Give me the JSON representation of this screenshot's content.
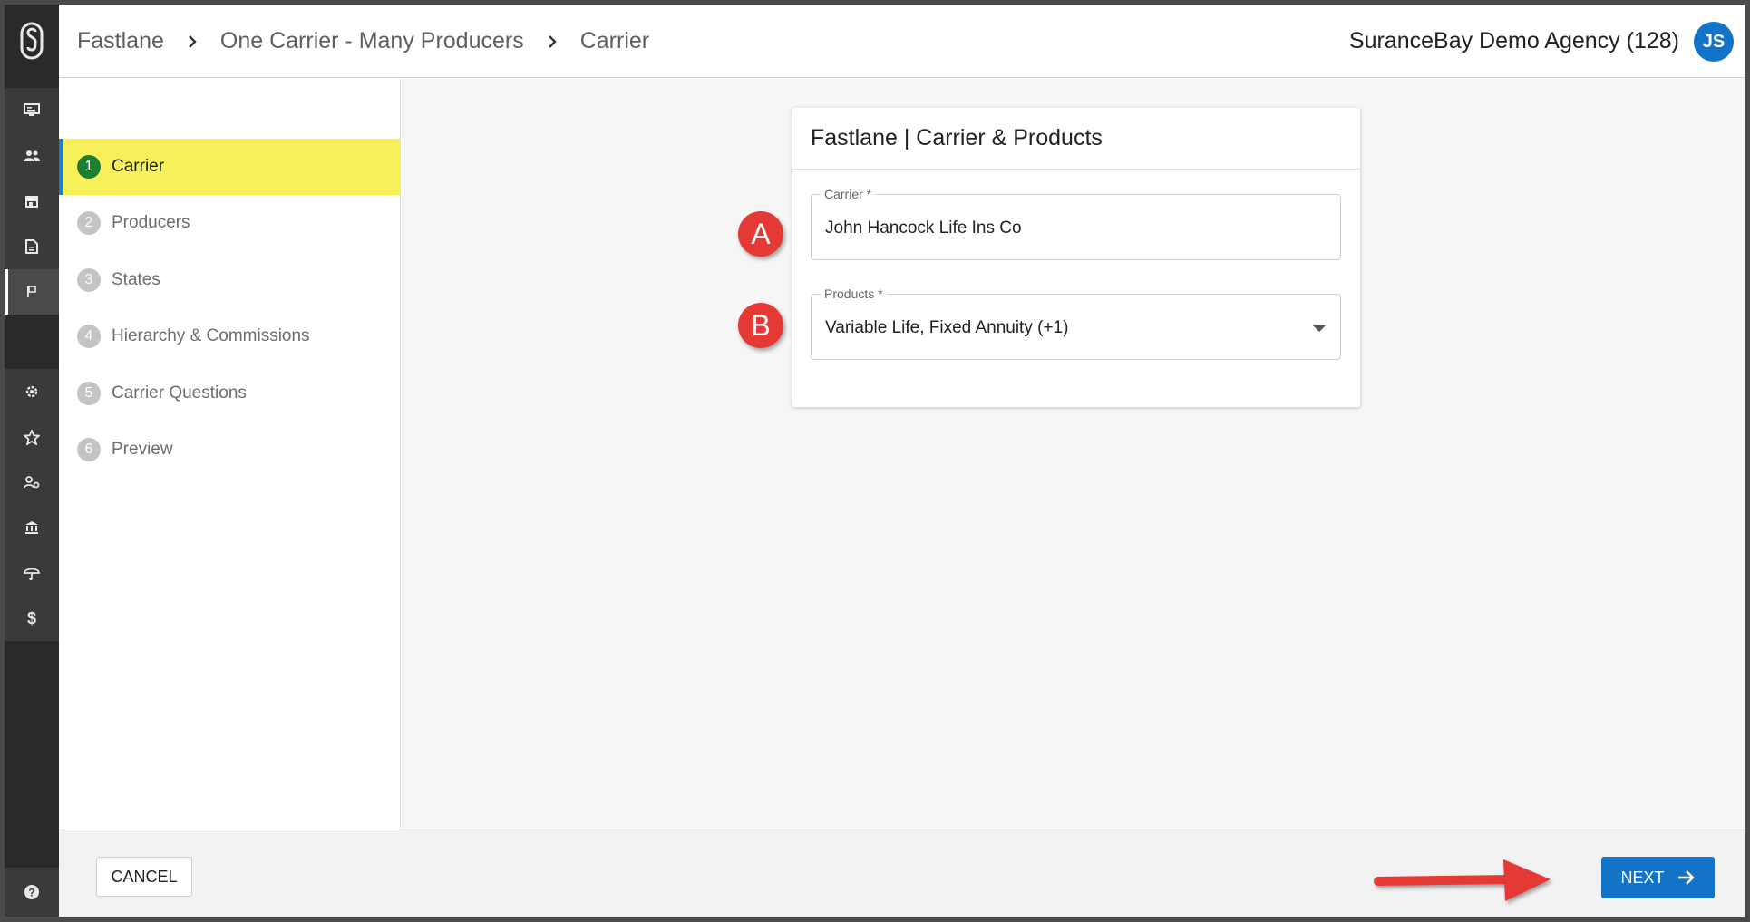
{
  "header": {
    "breadcrumbs": [
      "Fastlane",
      "One Carrier - Many Producers",
      "Carrier"
    ],
    "agency": "SuranceBay Demo Agency (128)",
    "avatar_initials": "JS"
  },
  "rail": {
    "items": [
      "monitor-icon",
      "people-icon",
      "store-icon",
      "document-icon",
      "flag-icon",
      "gear-icon",
      "star-icon",
      "user-settings-icon",
      "bank-icon",
      "umbrella-icon",
      "dollar-icon"
    ],
    "help": "help-icon"
  },
  "stepper": {
    "steps": [
      {
        "num": "1",
        "label": "Carrier"
      },
      {
        "num": "2",
        "label": "Producers"
      },
      {
        "num": "3",
        "label": "States"
      },
      {
        "num": "4",
        "label": "Hierarchy & Commissions"
      },
      {
        "num": "5",
        "label": "Carrier Questions"
      },
      {
        "num": "6",
        "label": "Preview"
      }
    ]
  },
  "card": {
    "title": "Fastlane | Carrier & Products",
    "carrier_label": "Carrier *",
    "carrier_value": "John Hancock Life Ins Co",
    "products_label": "Products *",
    "products_value": "Variable Life, Fixed Annuity (+1)"
  },
  "markers": {
    "a": "A",
    "b": "B"
  },
  "footer": {
    "cancel": "CANCEL",
    "next": "NEXT"
  },
  "colors": {
    "accent": "#1373c6",
    "active_step": "#f7f05a",
    "marker": "#e53935",
    "step_done": "#1b7f2f"
  }
}
